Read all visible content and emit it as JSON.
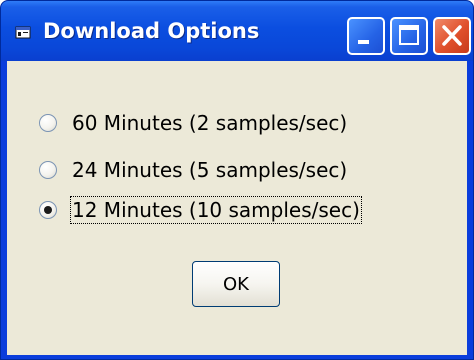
{
  "window": {
    "title": "Download Options",
    "title_icon": "app-window-icon",
    "controls": [
      "minimize-icon",
      "maximize-icon",
      "close-icon"
    ]
  },
  "options": [
    {
      "label": "60 Minutes (2 samples/sec)",
      "checked": false
    },
    {
      "label": "24 Minutes (5 samples/sec)",
      "checked": false
    },
    {
      "label": "12 Minutes (10 samples/sec)",
      "checked": true
    }
  ],
  "buttons": {
    "ok_label": "OK"
  },
  "colors": {
    "titlebar": "#0a47d8",
    "client_background": "#ece9d8",
    "close_button": "#e0502c"
  }
}
